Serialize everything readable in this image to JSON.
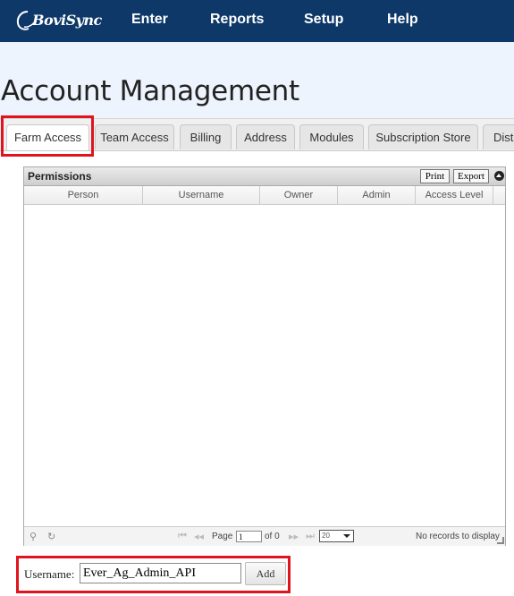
{
  "app": {
    "logo_text": "BoviSync",
    "brand_color": "#0d3868",
    "highlight_color": "#e0141e"
  },
  "nav": {
    "items": [
      {
        "label": "Enter"
      },
      {
        "label": "Reports"
      },
      {
        "label": "Setup"
      },
      {
        "label": "Help"
      }
    ]
  },
  "page": {
    "title": "Account Management"
  },
  "tabs": [
    {
      "label": "Farm Access",
      "active": true
    },
    {
      "label": "Team Access"
    },
    {
      "label": "Billing"
    },
    {
      "label": "Address"
    },
    {
      "label": "Modules"
    },
    {
      "label": "Subscription Store"
    },
    {
      "label": "Dist"
    }
  ],
  "grid": {
    "caption": "Permissions",
    "print_label": "Print",
    "export_label": "Export",
    "columns": [
      "Person",
      "Username",
      "Owner",
      "Admin",
      "Access Level"
    ],
    "rows": [],
    "pager": {
      "page_label": "Page",
      "page_value": "1",
      "of_label": "of 0",
      "rows_per_page": "20",
      "status": "No records to display"
    }
  },
  "add_user": {
    "label": "Username:",
    "value": "Ever_Ag_Admin_API",
    "button_label": "Add"
  }
}
